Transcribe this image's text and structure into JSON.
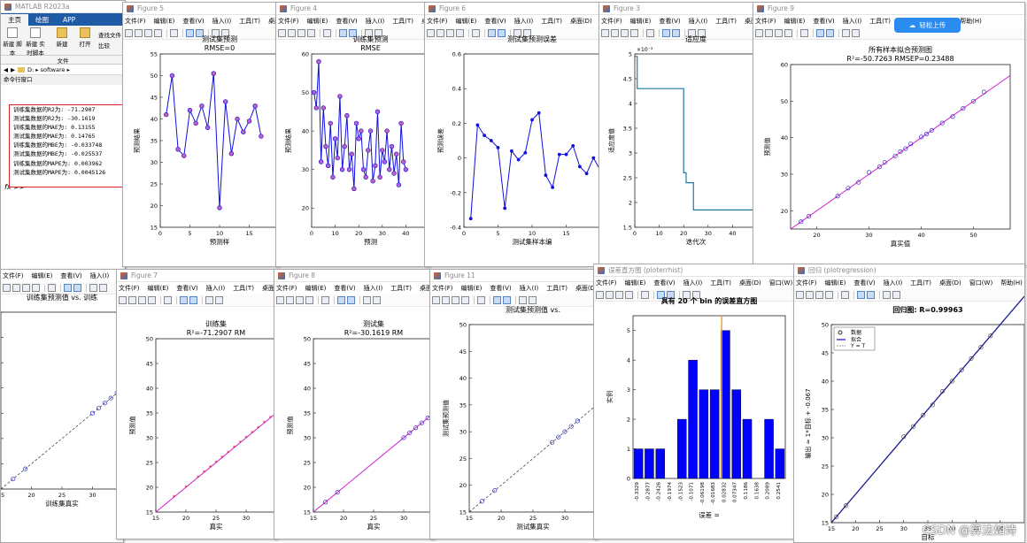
{
  "matlab": {
    "title": "MATLAB R2023a",
    "tabs": [
      "主页",
      "绘图",
      "APP"
    ],
    "buttons": [
      {
        "label": "新建\n脚本"
      },
      {
        "label": "新建\n实时脚本"
      },
      {
        "label": "新建"
      },
      {
        "label": "打开"
      },
      {
        "label": "查找文件"
      },
      {
        "label": "比较"
      }
    ],
    "file_group": "文件",
    "path": "D: ▸ software ▸",
    "cmd_title": "命令行窗口",
    "prompt": "fx >>",
    "output": [
      "训练集数据的R2为: -71.2907",
      "测试集数据的R2为: -30.1619",
      "训练集数据的MAE为: 0.13155",
      "测试集数据的MAE为: 0.14765",
      "训练集数据的MBE为: -0.033748",
      "测试集数据的MBE为: -0.025537",
      "训练集数据的MAPE为: 0.003962",
      "测试集数据的MAPE为: 0.0045126"
    ]
  },
  "menu_common": [
    "文件(F)",
    "编辑(E)",
    "查看(V)",
    "插入(I)",
    "工具(T)",
    "桌面(D)",
    "窗口(W)",
    "帮助(H)"
  ],
  "badge": "轻松上传",
  "watermark": "CSDN @算法如诗",
  "figures": {
    "f5": {
      "title": "Figure 5",
      "line1": "测试集预测",
      "line2": "RMSE=0",
      "xlabel": "预测样",
      "ylabel": "预测结果"
    },
    "f4": {
      "title": "Figure 4",
      "line1": "训练集预测",
      "line2": "RMSE",
      "xlabel": "预测",
      "ylabel": "预测结果"
    },
    "f6": {
      "title": "Figure 6",
      "line1": "测试集预测误差",
      "xlabel": "测试集样本编",
      "ylabel": "预测误差"
    },
    "f3": {
      "title": "Figure 3",
      "line1": "适应度",
      "exp": "×10⁻³",
      "xlabel": "迭代次",
      "ylabel": "适应度值"
    },
    "f9": {
      "title": "Figure 9",
      "line1": "所有样本拟合预测图",
      "line2": "R²=-50.7263  RMSEP=0.23488",
      "xlabel": "真实值",
      "ylabel": "预测值"
    },
    "f7": {
      "title": "Figure 7",
      "line1": "训练集",
      "line2": "R²=-71.2907  RM",
      "xlabel": "真实",
      "ylabel": "预测值"
    },
    "f8": {
      "title": "Figure 8",
      "line1": "测试集",
      "line2": "R²=-30.1619  RM",
      "xlabel": "真实",
      "ylabel": "预测值"
    },
    "f11": {
      "title": "Figure 11",
      "line1": "测试集预测值 vs.",
      "xlabel": "测试集真实",
      "ylabel": "测试集预测值"
    },
    "fleft": {
      "line1": "训练集预测值 vs. 训练",
      "xlabel": "训练集真实"
    },
    "fhist": {
      "title": "误差直方图 (ploterrhist)",
      "line1": "具有 20 个 bin 的误差直方图",
      "xlabel": "误差 =",
      "ylabel": "实例"
    },
    "freg": {
      "title": "回归 (plotregression)",
      "line1": "回归图: R=0.99963",
      "xlabel": "目标",
      "ylabel": "输出 ≈ 1*目标 + -0.067",
      "legend": [
        "数据",
        "拟合",
        "Y = T"
      ]
    }
  },
  "chart_data": [
    {
      "type": "line",
      "name": "f5",
      "ylim": [
        15,
        55
      ],
      "xlim": [
        0,
        20
      ],
      "y": [
        41,
        50,
        33,
        31.5,
        42,
        39,
        43,
        38,
        50.5,
        19.5,
        44,
        32,
        40,
        37,
        39.5,
        43,
        36
      ]
    },
    {
      "type": "line",
      "name": "f4",
      "ylim": [
        15,
        60
      ],
      "xlim": [
        0,
        50
      ],
      "y": [
        50,
        46,
        58,
        32,
        46,
        36,
        31,
        42,
        28,
        38,
        33,
        49,
        30,
        36,
        44,
        30,
        34,
        25,
        42,
        38,
        40,
        30,
        28,
        35,
        40,
        27,
        31,
        45,
        28,
        35,
        32,
        40,
        30,
        36,
        29,
        34,
        26,
        42,
        32,
        30
      ]
    },
    {
      "type": "line",
      "name": "f6",
      "ylim": [
        -0.4,
        0.6
      ],
      "xlim": [
        0,
        20
      ],
      "y": [
        -0.35,
        0.19,
        0.13,
        0.1,
        0.06,
        -0.29,
        0.04,
        -0.01,
        0.03,
        0.22,
        0.26,
        -0.1,
        -0.17,
        0.02,
        0.02,
        0.07,
        -0.05,
        -0.09,
        0.0,
        -0.07
      ]
    },
    {
      "type": "line",
      "name": "f3",
      "ylim": [
        1.5,
        5
      ],
      "xlim": [
        0,
        50
      ],
      "x": [
        0,
        1,
        1,
        3,
        3,
        20,
        20,
        21,
        21,
        22,
        22,
        24,
        24,
        50
      ],
      "y": [
        4.95,
        4.95,
        4.3,
        4.3,
        4.3,
        4.3,
        2.6,
        2.6,
        2.4,
        2.4,
        2.4,
        2.4,
        1.85,
        1.85
      ]
    },
    {
      "type": "scatter",
      "name": "f9",
      "xlim": [
        15,
        57
      ],
      "ylim": [
        15,
        60
      ],
      "x": [
        17,
        18.5,
        24,
        26,
        28,
        30,
        32,
        33,
        35,
        36,
        37,
        38,
        40,
        41,
        42,
        44,
        46,
        48,
        50,
        52
      ],
      "y": [
        17,
        18.5,
        24,
        26.2,
        27.8,
        30.5,
        32,
        33.2,
        35,
        36.2,
        37,
        38.3,
        40.2,
        41,
        42,
        44,
        45.8,
        48,
        50,
        52.5
      ]
    },
    {
      "type": "scatter",
      "name": "f7",
      "xlim": [
        15,
        35
      ],
      "ylim": [
        15,
        50
      ],
      "x": [
        18,
        20,
        22,
        23,
        24,
        25,
        26,
        27,
        28,
        29,
        30,
        31,
        32,
        33,
        34
      ],
      "y": [
        18,
        20,
        22,
        23,
        24,
        25,
        26,
        27,
        28,
        29,
        30,
        31,
        32,
        33,
        34
      ]
    },
    {
      "type": "scatter",
      "name": "f8",
      "xlim": [
        15,
        35
      ],
      "ylim": [
        15,
        50
      ],
      "x": [
        17,
        19,
        30,
        31,
        32,
        33,
        34,
        35
      ],
      "y": [
        17,
        19,
        30,
        31,
        32,
        33,
        34,
        35
      ]
    },
    {
      "type": "scatter",
      "name": "f11",
      "xlim": [
        15,
        35
      ],
      "ylim": [
        15,
        50
      ],
      "x": [
        17,
        19,
        28,
        29,
        30,
        31,
        32
      ],
      "y": [
        17,
        19,
        28,
        29,
        30,
        31,
        32
      ]
    },
    {
      "type": "bar",
      "name": "fhist",
      "ylim": [
        0,
        5.5
      ],
      "categories": [
        "-0.3329",
        "-0.2877",
        "-0.2426",
        "-0.1974",
        "-0.1523",
        "-0.1071",
        "-0.06198",
        "-0.01683",
        "0.02832",
        "0.07347",
        "0.1186",
        "0.1638",
        "0.2089",
        "0.2541"
      ],
      "values": [
        1,
        1,
        1,
        0,
        2,
        4,
        3,
        3,
        5,
        3,
        2,
        0,
        2,
        1
      ]
    },
    {
      "type": "scatter",
      "name": "freg",
      "xlim": [
        15,
        55
      ],
      "ylim": [
        15,
        50
      ],
      "x": [
        16,
        18,
        30,
        32,
        34,
        36,
        38,
        40,
        42,
        44,
        46,
        48
      ],
      "y": [
        16,
        18,
        30.2,
        32,
        34,
        35.8,
        38.2,
        40,
        42,
        44,
        46,
        48
      ]
    }
  ]
}
